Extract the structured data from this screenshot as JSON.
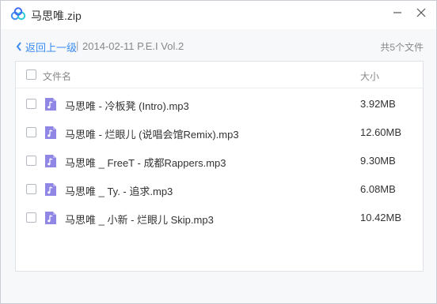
{
  "window": {
    "title": "马思唯.zip",
    "icons": {
      "logo": "baidu-netdisk-cloud-icon",
      "minimize": "minimize-icon",
      "close": "close-icon"
    }
  },
  "toolbar": {
    "back_label": "返回上一级",
    "separator": "|",
    "path": "2014-02-11 P.E.I Vol.2",
    "count_text": "共5个文件"
  },
  "list": {
    "header": {
      "name_label": "文件名",
      "size_label": "大小"
    },
    "files": [
      {
        "name": "马思唯 - 冷板凳 (Intro).mp3",
        "size": "3.92MB",
        "icon": "music-file-icon"
      },
      {
        "name": "马思唯 - 烂眼儿 (说唱会馆Remix).mp3",
        "size": "12.60MB",
        "icon": "music-file-icon"
      },
      {
        "name": "马思唯 _ FreeT - 成都Rappers.mp3",
        "size": "9.30MB",
        "icon": "music-file-icon"
      },
      {
        "name": "马思唯 _ Ty. - 追求.mp3",
        "size": "6.08MB",
        "icon": "music-file-icon"
      },
      {
        "name": "马思唯 _ 小新 - 烂眼儿 Skip.mp3",
        "size": "10.42MB",
        "icon": "music-file-icon"
      }
    ]
  },
  "colors": {
    "accent": "#3b8cf0",
    "file_icon": "#8f86e6"
  }
}
